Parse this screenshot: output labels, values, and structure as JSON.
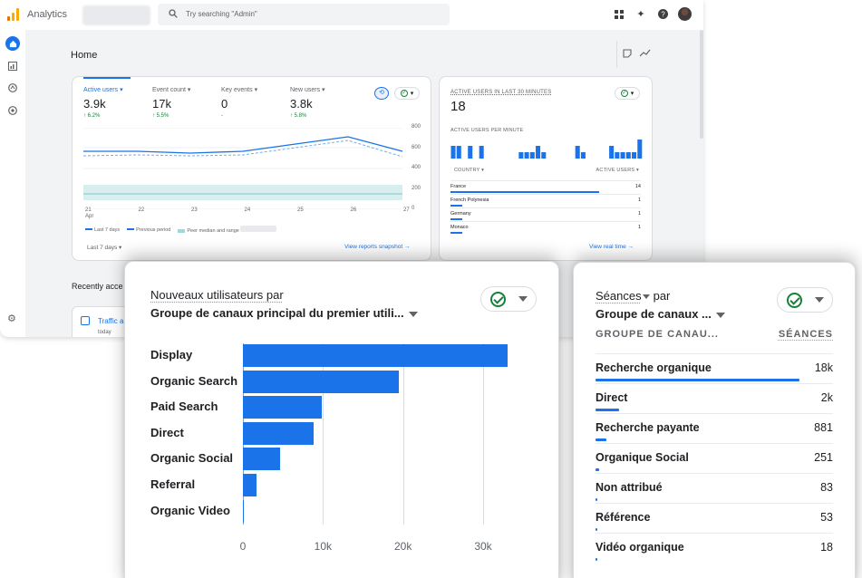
{
  "topbar": {
    "app_name": "Analytics",
    "search_placeholder": "Try searching \"Admin\""
  },
  "home": {
    "title": "Home",
    "metrics": [
      {
        "label": "Active users",
        "value": "3.9k",
        "delta": "6.2%"
      },
      {
        "label": "Event count",
        "value": "17k",
        "delta": "5.5%"
      },
      {
        "label": "Key events",
        "value": "0",
        "delta": "-"
      },
      {
        "label": "New users",
        "value": "3.8k",
        "delta": "5.8%"
      }
    ],
    "y_ticks": [
      "800",
      "600",
      "400",
      "200",
      "0"
    ],
    "x_ticks": [
      "21",
      "22",
      "23",
      "24",
      "25",
      "26",
      "27"
    ],
    "x_month": "Apr",
    "legend": [
      "Last 7 days",
      "Previous period",
      "Peer median and range"
    ],
    "date_range": "Last 7 days",
    "view_link": "View reports snapshot"
  },
  "realtime": {
    "title": "ACTIVE USERS IN LAST 30 MINUTES",
    "value": "18",
    "per_minute_label": "ACTIVE USERS PER MINUTE",
    "col_country": "COUNTRY",
    "col_users": "ACTIVE USERS",
    "rows": [
      {
        "country": "France",
        "users": "14",
        "share": 0.78
      },
      {
        "country": "French Polynesia",
        "users": "1",
        "share": 0.06
      },
      {
        "country": "Germany",
        "users": "1",
        "share": 0.06
      },
      {
        "country": "Monaco",
        "users": "1",
        "share": 0.06
      }
    ],
    "view_link": "View real time",
    "per_minute_values": [
      2,
      2,
      0,
      2,
      0,
      2,
      0,
      0,
      0,
      0,
      0,
      0,
      1,
      1,
      1,
      2,
      1,
      0,
      0,
      0,
      0,
      0,
      2,
      1,
      0,
      0,
      0,
      0,
      2,
      1,
      1,
      1,
      1,
      3
    ]
  },
  "recent": {
    "title": "Recently acce",
    "card_title": "Traffic a",
    "card_date": "today"
  },
  "new_users_card": {
    "title_line1": "Nouveaux utilisateurs par",
    "title_line2": "Groupe de canaux principal du premier utili...",
    "x_ticks": [
      "0",
      "10k",
      "20k",
      "30k"
    ]
  },
  "chart_data": {
    "type": "bar",
    "orientation": "horizontal",
    "title": "Nouveaux utilisateurs par Groupe de canaux principal du premier utili...",
    "categories": [
      "Display",
      "Organic Search",
      "Paid Search",
      "Direct",
      "Organic Social",
      "Referral",
      "Organic Video"
    ],
    "values": [
      33000,
      19500,
      9800,
      8800,
      4600,
      1700,
      100
    ],
    "xlim": [
      0,
      35000
    ],
    "grid": true
  },
  "sessions_card": {
    "title_line1": "Séances",
    "title_by": "par",
    "title_line2": "Groupe de canaux ...",
    "col_group": "GROUPE DE CANAU...",
    "col_sessions": "SÉANCES",
    "rows": [
      {
        "label": "Recherche organique",
        "value": "18k",
        "share": 0.86
      },
      {
        "label": "Direct",
        "value": "2k",
        "share": 0.1
      },
      {
        "label": "Recherche payante",
        "value": "881",
        "share": 0.045
      },
      {
        "label": "Organique Social",
        "value": "251",
        "share": 0.015
      },
      {
        "label": "Non attribué",
        "value": "83",
        "share": 0.006
      },
      {
        "label": "Référence",
        "value": "53",
        "share": 0.004
      },
      {
        "label": "Vidéo organique",
        "value": "18",
        "share": 0.002
      }
    ]
  },
  "colors": {
    "accent": "#1a73e8",
    "positive": "#188038",
    "logo_orange": "#f9ab00",
    "logo_dark": "#e37400"
  }
}
